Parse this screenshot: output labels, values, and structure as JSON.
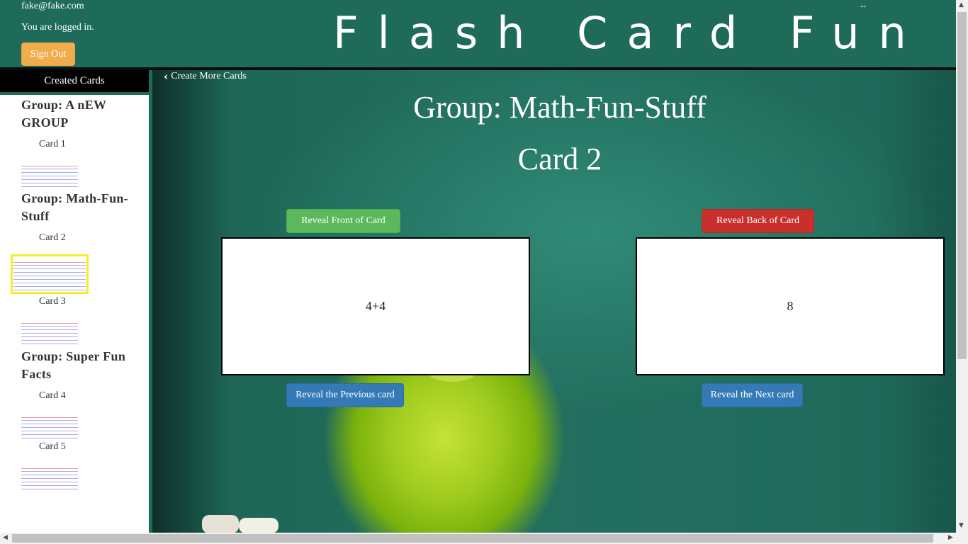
{
  "header": {
    "user_email": "fake@fake.com",
    "login_status": "You are logged in.",
    "sign_out_label": "Sign Out",
    "app_title": "Flash Card Fun"
  },
  "sidebar": {
    "heading": "Created Cards",
    "groups": [
      {
        "title": "Group: A nEW GROUP",
        "cards": [
          "Card 1"
        ]
      },
      {
        "title": "Group: Math-Fun-Stuff",
        "cards": [
          "Card 2",
          "Card 3"
        ]
      },
      {
        "title": "Group: Super Fun Facts",
        "cards": [
          "Card 4",
          "Card 5"
        ]
      }
    ],
    "selected_card": "Card 2"
  },
  "main": {
    "back_link": "Create More Cards",
    "group_heading": "Group: Math-Fun-Stuff",
    "card_heading": "Card 2",
    "reveal_front_label": "Reveal Front of Card",
    "reveal_back_label": "Reveal Back of Card",
    "front_text": "4+4",
    "back_text": "8",
    "prev_label": "Reveal the Previous card",
    "next_label": "Reveal the Next card"
  },
  "colors": {
    "header_bg": "#1f6b5a",
    "sign_out": "#f0ad4e",
    "reveal_front": "#5cb85c",
    "reveal_back": "#c9302c",
    "nav_buttons": "#337ab7",
    "selection_frame": "#f5ee27"
  },
  "icons": {
    "back_link": "chevron-left-icon",
    "window": "resize-arrows-icon"
  }
}
